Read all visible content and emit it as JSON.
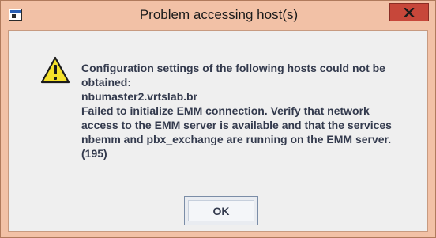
{
  "window": {
    "title": "Problem accessing host(s)"
  },
  "icons": {
    "app": "app-icon",
    "close": "close-icon",
    "warning": "warning-icon"
  },
  "message": {
    "lines": [
      "Configuration settings of the following hosts could not be",
      "obtained:",
      "nbumaster2.vrtslab.br",
      "Failed to initialize EMM connection.  Verify that network",
      "access to the EMM server is available and that the services",
      "nbemm and pbx_exchange are running on the EMM server.",
      "(195)"
    ]
  },
  "buttons": {
    "ok_label": "OK"
  },
  "colors": {
    "titlebar": "#f2c1a6",
    "close_button": "#c7473a",
    "dialog_background": "#efefef",
    "text": "#333a4d",
    "warning_yellow": "#f5e12b"
  }
}
